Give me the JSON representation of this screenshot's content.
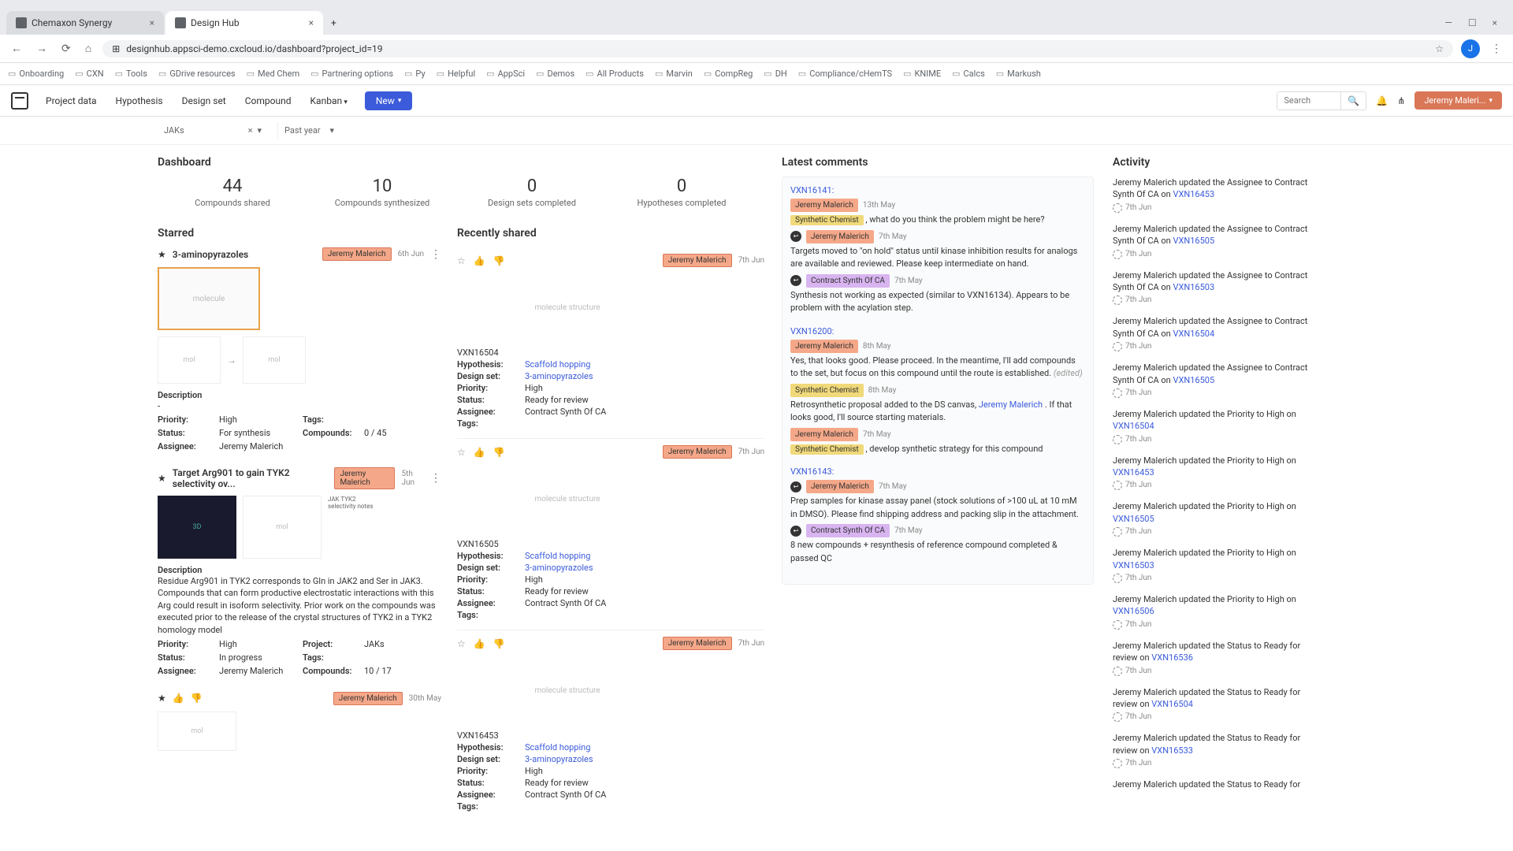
{
  "browser": {
    "tabs": [
      {
        "title": "Chemaxon Synergy",
        "active": false
      },
      {
        "title": "Design Hub",
        "active": true
      }
    ],
    "url": "designhub.appsci-demo.cxcloud.io/dashboard?project_id=19",
    "bookmarks": [
      "Onboarding",
      "CXN",
      "Tools",
      "GDrive resources",
      "Med Chem",
      "Partnering options",
      "Py",
      "Helpful",
      "AppSci",
      "Demos",
      "All Products",
      "Marvin",
      "CompReg",
      "DH",
      "Compliance/cHemTS",
      "KNIME",
      "Calcs",
      "Markush"
    ]
  },
  "header": {
    "nav": [
      "Project data",
      "Hypothesis",
      "Design set",
      "Compound",
      "Kanban"
    ],
    "new_btn": "New",
    "search_placeholder": "Search",
    "user": "Jeremy Maleri..."
  },
  "filters": {
    "project": "JAKs",
    "timerange": "Past year"
  },
  "dashboard": {
    "title": "Dashboard",
    "stats": [
      {
        "value": "44",
        "label": "Compounds shared"
      },
      {
        "value": "10",
        "label": "Compounds synthesized"
      },
      {
        "value": "0",
        "label": "Design sets completed"
      },
      {
        "value": "0",
        "label": "Hypotheses completed"
      }
    ]
  },
  "starred": {
    "title": "Starred",
    "items": [
      {
        "title": "3-aminopyrazoles",
        "author": "Jeremy Malerich",
        "date": "6th Jun",
        "desc_label": "Description",
        "desc": "-",
        "meta": {
          "Priority": "High",
          "Tags": "",
          "Status": "For synthesis",
          "Compounds": "0 / 45",
          "Assignee": "Jeremy Malerich"
        }
      },
      {
        "title": "Target Arg901 to gain TYK2 selectivity ov...",
        "author": "Jeremy Malerich",
        "date": "5th Jun",
        "desc_label": "Description",
        "desc": "Residue Arg901 in TYK2 corresponds to Gln in JAK2 and Ser in JAK3. Compounds that can form productive electrostatic interactions with this Arg could result in isoform selectivity. Prior work on the compounds was executed prior to the release of the crystal structures of TYK2 in a TYK2 homology model",
        "meta": {
          "Priority": "High",
          "Project": "JAKs",
          "Status": "In progress",
          "Tags": "",
          "Assignee": "Jeremy Malerich",
          "Compounds": "10 / 17"
        }
      },
      {
        "author": "Jeremy Malerich",
        "date": "30th May"
      }
    ]
  },
  "recent": {
    "title": "Recently shared",
    "items": [
      {
        "id": "VXN16504",
        "author": "Jeremy Malerich",
        "date": "7th Jun",
        "Hypothesis": "Scaffold hopping",
        "Design set": "3-aminopyrazoles",
        "Priority": "High",
        "Status": "Ready for review",
        "Assignee": "Contract Synth Of CA",
        "Tags": ""
      },
      {
        "id": "VXN16505",
        "author": "Jeremy Malerich",
        "date": "7th Jun",
        "Hypothesis": "Scaffold hopping",
        "Design set": "3-aminopyrazoles",
        "Priority": "High",
        "Status": "Ready for review",
        "Assignee": "Contract Synth Of CA",
        "Tags": ""
      },
      {
        "id": "VXN16453",
        "author": "Jeremy Malerich",
        "date": "7th Jun",
        "Hypothesis": "Scaffold hopping",
        "Design set": "3-aminopyrazoles",
        "Priority": "High",
        "Status": "Ready for review",
        "Assignee": "Contract Synth Of CA",
        "Tags": ""
      }
    ]
  },
  "comments": {
    "title": "Latest comments",
    "threads": [
      {
        "id": "VXN16141",
        "lines": [
          {
            "tag": "jm",
            "who": "Jeremy Malerich",
            "date": "13th May",
            "text": ", what do you think the problem might be here?",
            "pre": "Synthetic Chemist",
            "pretag": "sc"
          },
          {
            "icon": true,
            "tag": "jm",
            "who": "Jeremy Malerich",
            "date": "7th May",
            "text": "Targets moved to \"on hold\" status until kinase inhibition results for analogs are available and reviewed. Please keep intermediate on hand."
          },
          {
            "icon": true,
            "tag": "cs",
            "who": "Contract Synth Of CA",
            "date": "7th May",
            "text": "Synthesis not working as expected (similar to VXN16134). Appears to be problem with the acylation step."
          }
        ]
      },
      {
        "id": "VXN16200",
        "lines": [
          {
            "tag": "jm",
            "who": "Jeremy Malerich",
            "date": "8th May",
            "text": "Yes, that looks good. Please proceed.  In the meantime, I'll add compounds to the set, but focus on this compound until the route is established.",
            "edited": "(edited)"
          },
          {
            "tag": "sc",
            "who": "Synthetic Chemist",
            "date": "8th May",
            "text": "Retrosynthetic proposal added to the DS canvas, ",
            "link": "Jeremy Malerich",
            "after": ". If that looks good, I'll source starting materials."
          },
          {
            "tag": "jm",
            "who": "Jeremy Malerich",
            "date": "7th May",
            "text": ", develop synthetic strategy for this compound",
            "pre": "Synthetic Chemist",
            "pretag": "sc"
          }
        ]
      },
      {
        "id": "VXN16143",
        "lines": [
          {
            "icon": true,
            "tag": "jm",
            "who": "Jeremy Malerich",
            "date": "7th May",
            "text": "Prep samples for kinase assay panel (stock solutions of >100 uL at 10 mM in DMSO). Please find shipping address and packing slip in the attachment."
          },
          {
            "icon": true,
            "tag": "cs",
            "who": "Contract Synth Of CA",
            "date": "7th May",
            "text": "8 new compounds + resynthesis of reference compound completed & passed QC"
          }
        ]
      }
    ]
  },
  "activity": {
    "title": "Activity",
    "items": [
      {
        "text": "Jeremy Malerich updated the Assignee to Contract Synth Of CA on ",
        "link": "VXN16453",
        "date": "7th Jun"
      },
      {
        "text": "Jeremy Malerich updated the Assignee to Contract Synth Of CA on ",
        "link": "VXN16505",
        "date": "7th Jun"
      },
      {
        "text": "Jeremy Malerich updated the Assignee to Contract Synth Of CA on ",
        "link": "VXN16503",
        "date": "7th Jun"
      },
      {
        "text": "Jeremy Malerich updated the Assignee to Contract Synth Of CA on ",
        "link": "VXN16504",
        "date": "7th Jun"
      },
      {
        "text": "Jeremy Malerich updated the Assignee to Contract Synth Of CA on ",
        "link": "VXN16505",
        "date": "7th Jun"
      },
      {
        "text": "Jeremy Malerich updated the Priority to High on ",
        "link": "VXN16504",
        "date": "7th Jun"
      },
      {
        "text": "Jeremy Malerich updated the Priority to High on ",
        "link": "VXN16453",
        "date": "7th Jun"
      },
      {
        "text": "Jeremy Malerich updated the Priority to High on ",
        "link": "VXN16505",
        "date": "7th Jun"
      },
      {
        "text": "Jeremy Malerich updated the Priority to High on ",
        "link": "VXN16503",
        "date": "7th Jun"
      },
      {
        "text": "Jeremy Malerich updated the Priority to High on ",
        "link": "VXN16506",
        "date": "7th Jun"
      },
      {
        "text": "Jeremy Malerich updated the Status to Ready for review on ",
        "link": "VXN16536",
        "date": "7th Jun"
      },
      {
        "text": "Jeremy Malerich updated the Status to Ready for review on ",
        "link": "VXN16504",
        "date": "7th Jun"
      },
      {
        "text": "Jeremy Malerich updated the Status to Ready for review on ",
        "link": "VXN16533",
        "date": "7th Jun"
      },
      {
        "text": "Jeremy Malerich updated the Status to Ready for",
        "link": "",
        "date": ""
      }
    ]
  }
}
